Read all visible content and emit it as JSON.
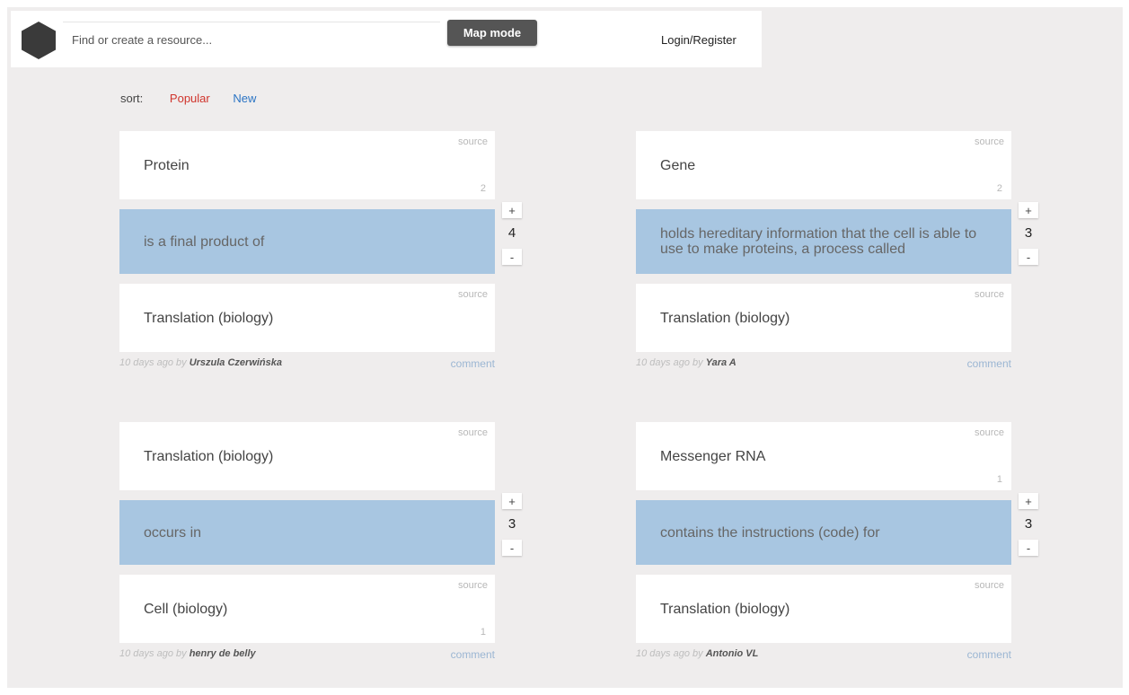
{
  "header": {
    "search_placeholder": "Find or create a resource...",
    "map_mode_label": "Map mode",
    "login_label": "Login/Register"
  },
  "sort": {
    "label": "sort:",
    "popular": "Popular",
    "new": "New"
  },
  "cards": [
    {
      "top": {
        "name": "Protein",
        "source": "source",
        "count": "2"
      },
      "relation": "is a final product of",
      "votes": {
        "plus": "+",
        "count": "4",
        "minus": "-"
      },
      "bottom": {
        "name": "Translation (biology)",
        "source": "source",
        "count": ""
      },
      "meta": {
        "time": "10 days ago by",
        "author": "Urszula Czerwińska",
        "comment": "comment"
      }
    },
    {
      "top": {
        "name": "Gene",
        "source": "source",
        "count": "2"
      },
      "relation": "holds hereditary information that the cell is able to use to make proteins, a process called",
      "votes": {
        "plus": "+",
        "count": "3",
        "minus": "-"
      },
      "bottom": {
        "name": "Translation (biology)",
        "source": "source",
        "count": ""
      },
      "meta": {
        "time": "10 days ago by",
        "author": "Yara A",
        "comment": "comment"
      }
    },
    {
      "top": {
        "name": "Translation (biology)",
        "source": "source",
        "count": ""
      },
      "relation": "occurs in",
      "votes": {
        "plus": "+",
        "count": "3",
        "minus": "-"
      },
      "bottom": {
        "name": "Cell (biology)",
        "source": "source",
        "count": "1"
      },
      "meta": {
        "time": "10 days ago by",
        "author": "henry de belly",
        "comment": "comment"
      }
    },
    {
      "top": {
        "name": "Messenger RNA",
        "source": "source",
        "count": "1"
      },
      "relation": "contains the instructions (code) for",
      "votes": {
        "plus": "+",
        "count": "3",
        "minus": "-"
      },
      "bottom": {
        "name": "Translation (biology)",
        "source": "source",
        "count": ""
      },
      "meta": {
        "time": "10 days ago by",
        "author": "Antonio VL",
        "comment": "comment"
      }
    }
  ],
  "colors": {
    "relation_bg": "#a8c6e1",
    "popular": "#d0342c",
    "new": "#2b74c4",
    "map_mode_bg": "#555555"
  }
}
